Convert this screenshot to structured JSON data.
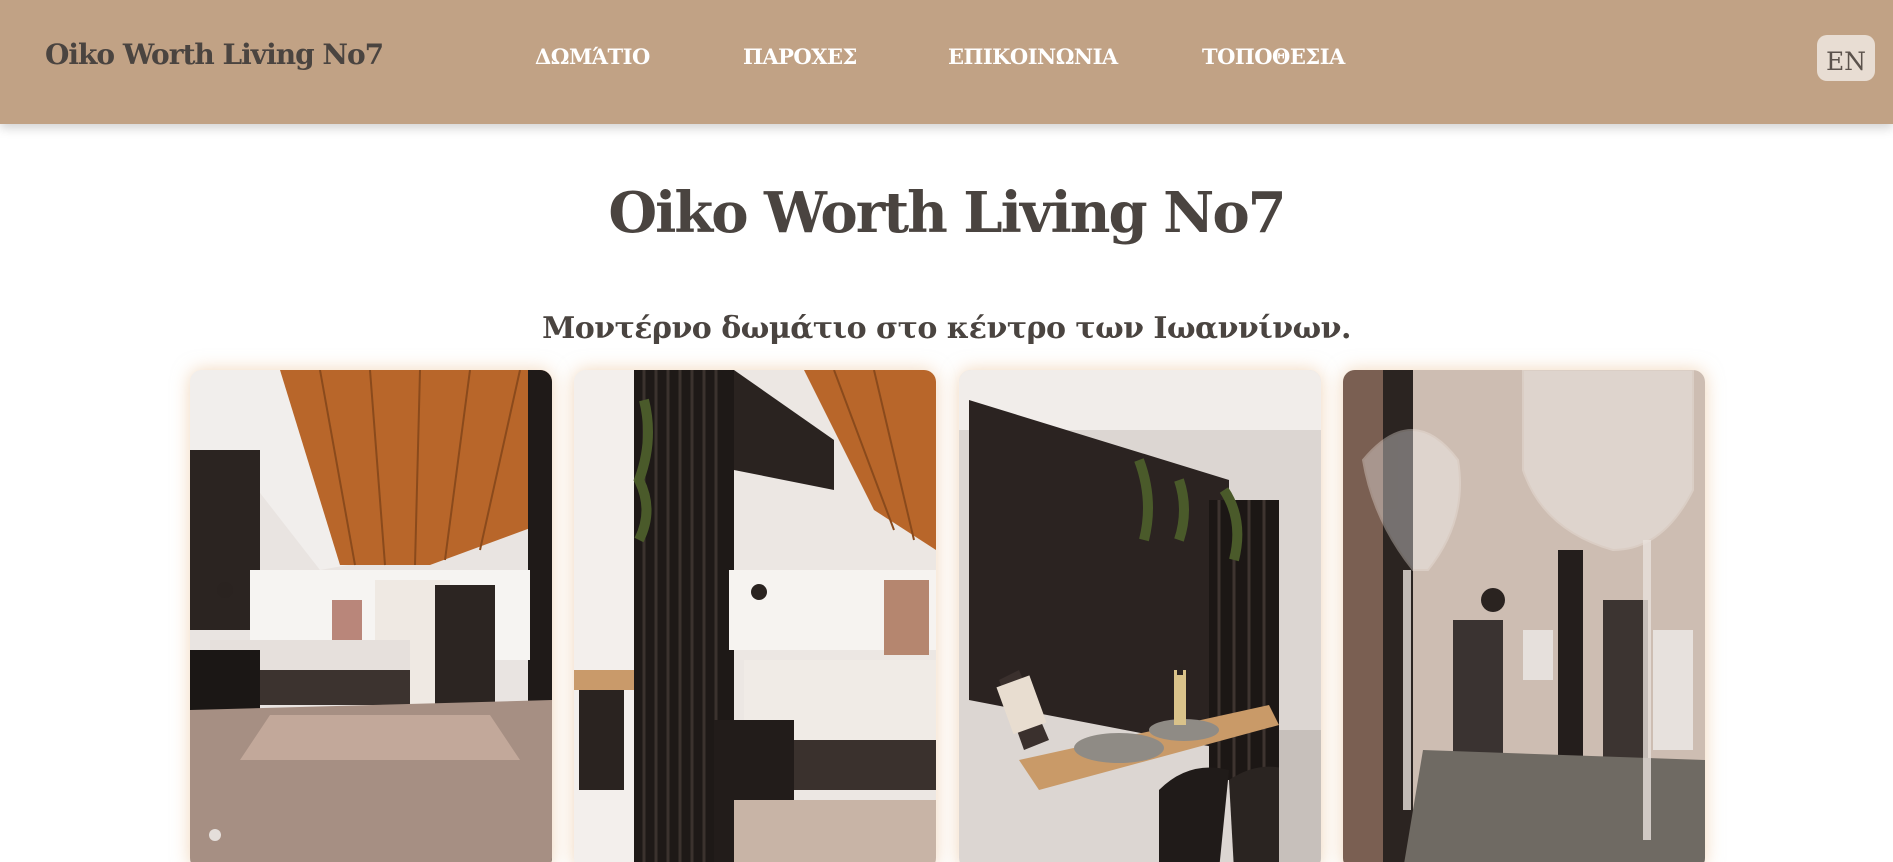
{
  "header": {
    "brand": "Oiko Worth Living No7",
    "nav": [
      {
        "label": "ΔΩΜΆΤΙΟ"
      },
      {
        "label": "ΠΑΡΟΧΕΣ"
      },
      {
        "label": "ΕΠΙΚΟΙΝΩΝΙΑ"
      },
      {
        "label": "ΤΟΠΟΘΕΣΙΑ"
      }
    ],
    "language": "EN"
  },
  "hero": {
    "title": "Oiko Worth Living No7",
    "subtitle": "Μοντέρνο δωμάτιο στο κέντρο των Ιωαννίνων."
  },
  "gallery": [
    {
      "subject": "bedroom-wooden-ceiling-photo"
    },
    {
      "subject": "bed-and-slatted-partition-photo"
    },
    {
      "subject": "desk-with-wine-bottle-photo"
    },
    {
      "subject": "wine-glasses-entrance-photo"
    }
  ],
  "colors": {
    "header_bg": "#c1a285",
    "text": "#4a4440",
    "nav_text": "#ffffff",
    "lang_bg": "#e8ddd3"
  }
}
